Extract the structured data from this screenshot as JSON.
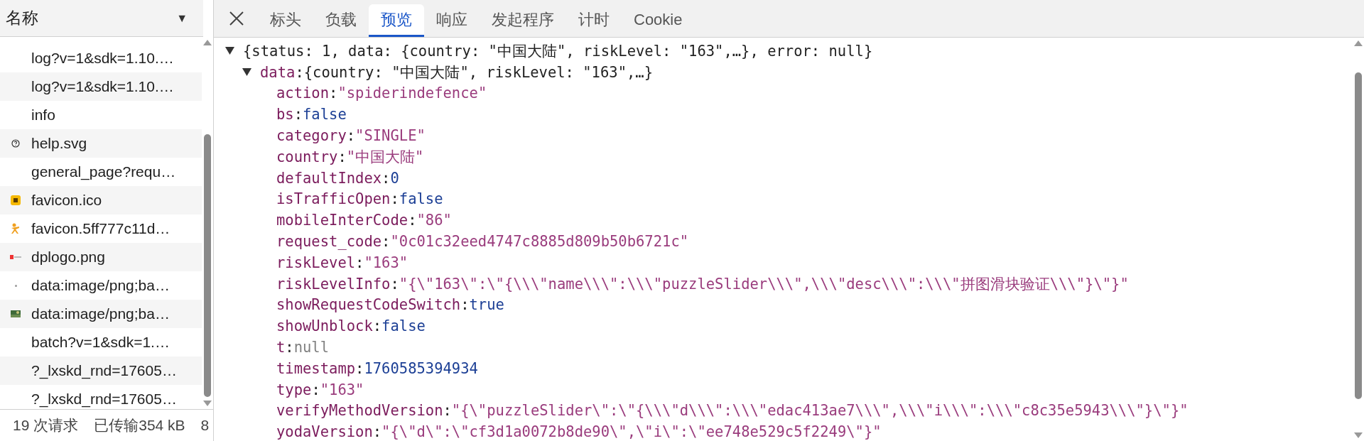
{
  "request_list": {
    "header": {
      "label": "名称",
      "sort_icon": "▼"
    },
    "rows": [
      {
        "name": "log?v=1&sdk=1.10.…"
      },
      {
        "name": "log?v=1&sdk=1.10.…"
      },
      {
        "name": "info"
      },
      {
        "name": "help.svg"
      },
      {
        "name": "general_page?requ…"
      },
      {
        "name": "favicon.ico"
      },
      {
        "name": "favicon.5ff777c11d…"
      },
      {
        "name": "dplogo.png"
      },
      {
        "name": "data:image/png;ba…"
      },
      {
        "name": "data:image/png;ba…"
      },
      {
        "name": "batch?v=1&sdk=1.…"
      },
      {
        "name": "?_lxskd_rnd=17605…"
      },
      {
        "name": "?_lxskd_rnd=17605…"
      }
    ],
    "status_bar": [
      "19 次请求",
      "已传输354 kB",
      "8"
    ]
  },
  "tabs": [
    {
      "label": "标头",
      "selected": false
    },
    {
      "label": "负载",
      "selected": false
    },
    {
      "label": "预览",
      "selected": true
    },
    {
      "label": "响应",
      "selected": false
    },
    {
      "label": "发起程序",
      "selected": false
    },
    {
      "label": "计时",
      "selected": false
    },
    {
      "label": "Cookie",
      "selected": false
    }
  ],
  "preview": {
    "summary": "{status: 1, data: {country: \"中国大陆\", riskLevel: \"163\",…}, error: null}",
    "expanded": true,
    "data": {
      "key": "data:",
      "summary": "{country: \"中国大陆\", riskLevel: \"163\",…}",
      "expanded": true,
      "properties": [
        {
          "key": "action:",
          "value": "\"spiderindefence\"",
          "kind": "string"
        },
        {
          "key": "bs:",
          "value": "false",
          "kind": "literal"
        },
        {
          "key": "category:",
          "value": "\"SINGLE\"",
          "kind": "string"
        },
        {
          "key": "country:",
          "value": "\"中国大陆\"",
          "kind": "string"
        },
        {
          "key": "defaultIndex:",
          "value": "0",
          "kind": "literal"
        },
        {
          "key": "isTrafficOpen:",
          "value": "false",
          "kind": "literal"
        },
        {
          "key": "mobileInterCode:",
          "value": "\"86\"",
          "kind": "string"
        },
        {
          "key": "request_code:",
          "value": "\"0c01c32eed4747c8885d809b50b6721c\"",
          "kind": "string"
        },
        {
          "key": "riskLevel:",
          "value": "\"163\"",
          "kind": "string"
        },
        {
          "key": "riskLevelInfo:",
          "value": "\"{\\\"163\\\":\\\"{\\\\\\\"name\\\\\\\":\\\\\\\"puzzleSlider\\\\\\\",\\\\\\\"desc\\\\\\\":\\\\\\\"拼图滑块验证\\\\\\\"}\\\"}\"",
          "kind": "string"
        },
        {
          "key": "showRequestCodeSwitch:",
          "value": "true",
          "kind": "literal"
        },
        {
          "key": "showUnblock:",
          "value": "false",
          "kind": "literal"
        },
        {
          "key": "t:",
          "value": "null",
          "kind": "null"
        },
        {
          "key": "timestamp:",
          "value": "1760585394934",
          "kind": "literal"
        },
        {
          "key": "type:",
          "value": "\"163\"",
          "kind": "string"
        },
        {
          "key": "verifyMethodVersion:",
          "value": "\"{\\\"puzzleSlider\\\":\\\"{\\\\\\\"d\\\\\\\":\\\\\\\"edac413ae7\\\\\\\",\\\\\\\"i\\\\\\\":\\\\\\\"c8c35e5943\\\\\\\"}\\\"}\"",
          "kind": "string"
        },
        {
          "key": "yodaVersion:",
          "value": "\"{\\\"d\\\":\\\"cf3d1a0072b8de90\\\",\\\"i\\\":\\\"ee748e529c5f2249\\\"}\"",
          "kind": "string"
        }
      ]
    }
  }
}
